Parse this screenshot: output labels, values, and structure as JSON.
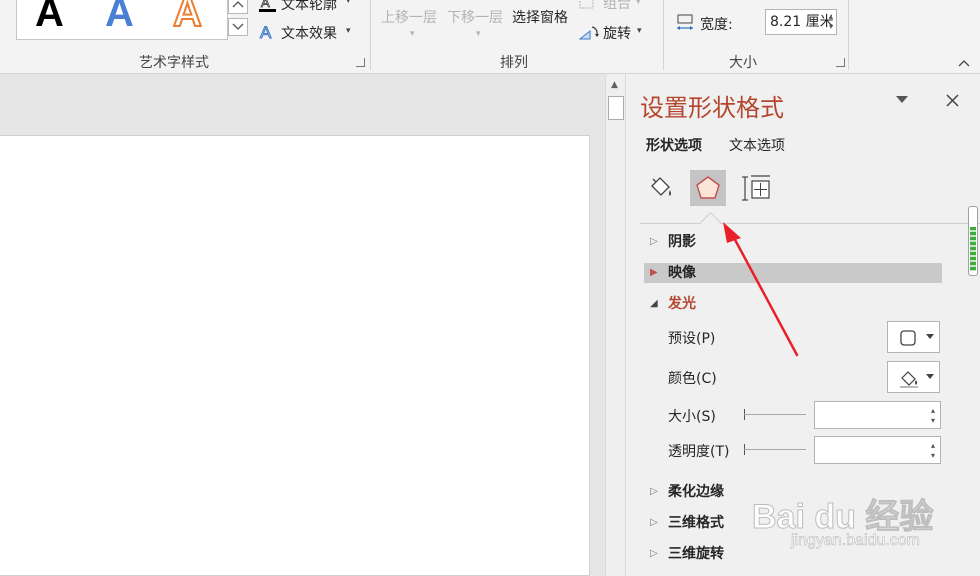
{
  "ribbon": {
    "wordart_samples": [
      "A",
      "A",
      "A"
    ],
    "text_outline_label": "文本轮廓",
    "text_effect_label": "文本效果",
    "wordart_group_label": "艺术字样式",
    "bring_forward_label": "上移一层",
    "send_backward_label": "下移一层",
    "selection_pane_label": "选择窗格",
    "group_label_btn": "组合",
    "rotate_label": "旋转",
    "arrange_group_label": "排列",
    "width_label": "宽度:",
    "width_value": "8.21 厘米",
    "size_group_label": "大小"
  },
  "pane": {
    "title": "设置形状格式",
    "tabs": {
      "shape_options": "形状选项",
      "text_options": "文本选项"
    },
    "sections": {
      "shadow": "阴影",
      "reflection": "映像",
      "glow": "发光",
      "soft_edges": "柔化边缘",
      "format_3d": "三维格式",
      "rotation_3d": "三维旋转"
    },
    "glow_props": {
      "preset_label": "预设(P)",
      "color_label": "颜色(C)",
      "size_label": "大小(S)",
      "transparency_label": "透明度(T)",
      "size_value": "",
      "transparency_value": ""
    }
  },
  "colors": {
    "accent_title": "#b5462e",
    "annotation_arrow": "#e8202a"
  },
  "icons": {
    "fill": "paint-bucket-icon",
    "effects": "pentagon-icon",
    "size_properties": "size-properties-icon"
  },
  "watermark": {
    "brand": "Bai du 经验",
    "url": "jingyan.baidu.com"
  }
}
